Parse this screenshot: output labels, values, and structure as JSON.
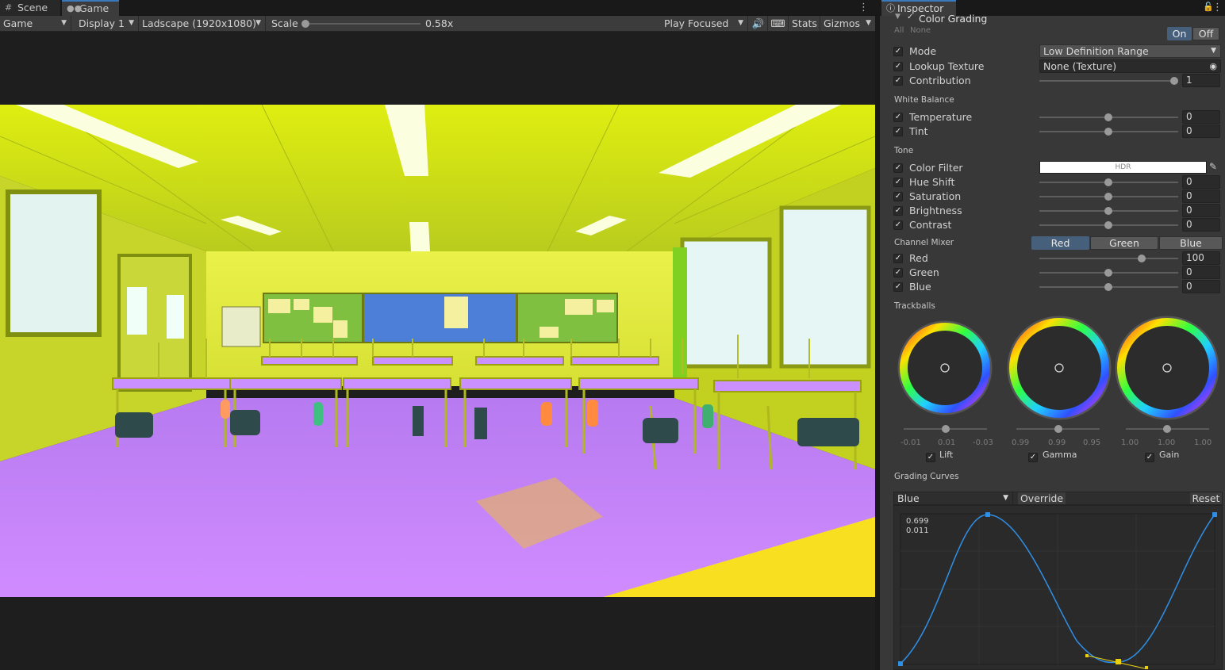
{
  "tabs": {
    "scene": "Scene",
    "game": "Game"
  },
  "toolbar": {
    "game_dropdown": "Game",
    "display": "Display 1",
    "resolution": "Ladscape (1920x1080)",
    "scale_label": "Scale",
    "scale_value": "0.58x",
    "play_focused": "Play Focused",
    "stats": "Stats",
    "gizmos": "Gizmos"
  },
  "inspector": {
    "tab_title": "Inspector",
    "component": "Color Grading",
    "all_label": "All",
    "none_label": "None",
    "on_label": "On",
    "off_label": "Off",
    "mode_label": "Mode",
    "mode_value": "Low Definition Range",
    "lookup_label": "Lookup Texture",
    "lookup_value": "None (Texture)",
    "contribution_label": "Contribution",
    "contribution_value": "1",
    "white_balance_header": "White Balance",
    "temperature_label": "Temperature",
    "temperature_value": "0",
    "tint_label": "Tint",
    "tint_value": "0",
    "tone_header": "Tone",
    "color_filter_label": "Color Filter",
    "color_filter_text": "HDR",
    "hue_shift_label": "Hue Shift",
    "hue_shift_value": "0",
    "saturation_label": "Saturation",
    "saturation_value": "0",
    "brightness_label": "Brightness",
    "brightness_value": "0",
    "contrast_label": "Contrast",
    "contrast_value": "0",
    "channel_mixer_header": "Channel Mixer",
    "mixer_tabs": [
      "Red",
      "Green",
      "Blue"
    ],
    "mixer_red_label": "Red",
    "mixer_red_value": "100",
    "mixer_green_label": "Green",
    "mixer_green_value": "0",
    "mixer_blue_label": "Blue",
    "mixer_blue_value": "0",
    "trackballs_header": "Trackballs",
    "lift_label": "Lift",
    "lift_values": [
      "-0.01",
      "0.01",
      "-0.03"
    ],
    "gamma_label": "Gamma",
    "gamma_values": [
      "0.99",
      "0.99",
      "0.95"
    ],
    "gain_label": "Gain",
    "gain_values": [
      "1.00",
      "1.00",
      "1.00"
    ],
    "grading_curves_header": "Grading Curves",
    "curve_channel": "Blue",
    "override_label": "Override",
    "reset_label": "Reset",
    "curve_readout_1": "0.699",
    "curve_readout_2": "0.011"
  },
  "colors": {
    "accent": "#3a79bb",
    "selected_tab": "#46607c",
    "curve": "#2f8fe6",
    "tint_yellow": "#e8f000",
    "tint_floor": "#c98cff"
  }
}
